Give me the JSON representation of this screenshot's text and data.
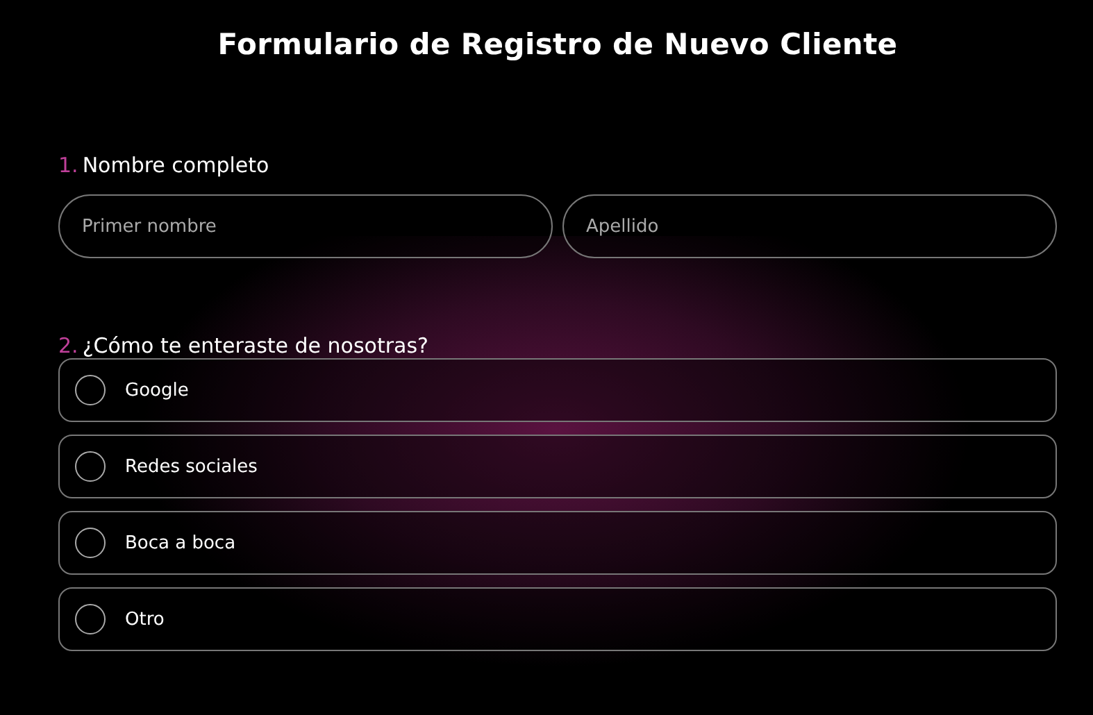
{
  "title": "Formulario de Registro de Nuevo Cliente",
  "questions": [
    {
      "kind": "name",
      "number": "1.",
      "label": "Nombre completo",
      "fields": [
        {
          "placeholder": "Primer nombre"
        },
        {
          "placeholder": "Apellido"
        }
      ]
    },
    {
      "kind": "choice",
      "number": "2.",
      "label": "¿Cómo te enteraste de nosotras?",
      "options": [
        {
          "label": "Google",
          "selected": false
        },
        {
          "label": "Redes sociales",
          "selected": false
        },
        {
          "label": "Boca a boca",
          "selected": false
        },
        {
          "label": "Otro",
          "selected": false
        }
      ]
    }
  ]
}
